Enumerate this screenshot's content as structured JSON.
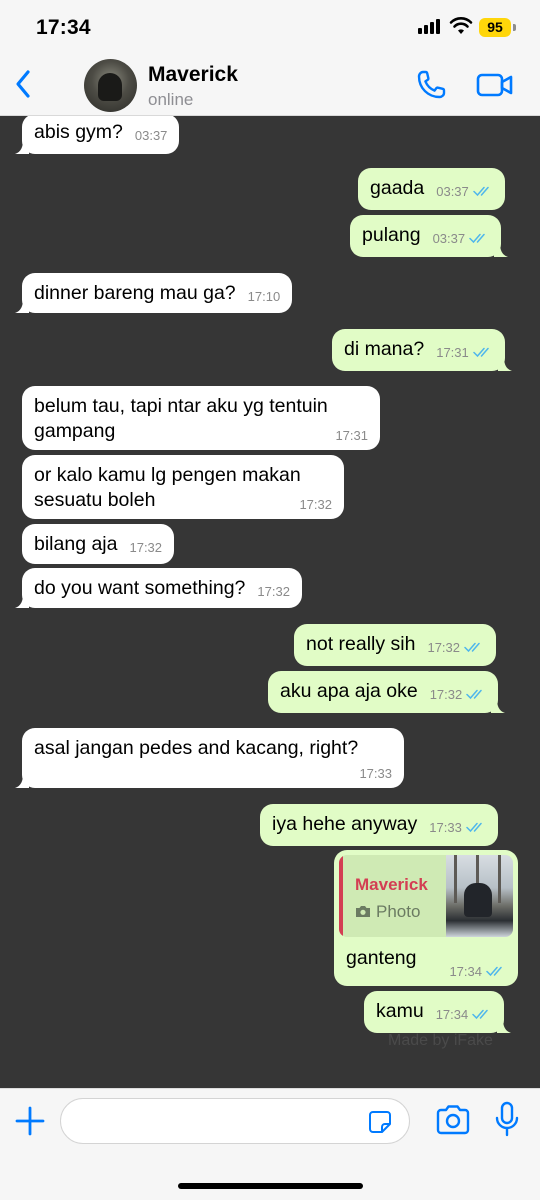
{
  "status": {
    "time": "17:34",
    "battery": "95"
  },
  "header": {
    "name": "Maverick",
    "status": "online"
  },
  "messages": [
    {
      "dir": "in",
      "text": "abis gym?",
      "time": "03:37"
    },
    {
      "dir": "out",
      "text": "gaada",
      "time": "03:37"
    },
    {
      "dir": "out",
      "text": "pulang",
      "time": "03:37"
    },
    {
      "dir": "in",
      "text": "dinner bareng mau ga?",
      "time": "17:10"
    },
    {
      "dir": "out",
      "text": "di mana?",
      "time": "17:31"
    },
    {
      "dir": "in",
      "text": "belum tau, tapi ntar aku yg tentuin gampang",
      "time": "17:31"
    },
    {
      "dir": "in",
      "text": "or kalo kamu lg pengen makan sesuatu boleh",
      "time": "17:32"
    },
    {
      "dir": "in",
      "text": "bilang aja",
      "time": "17:32"
    },
    {
      "dir": "in",
      "text": "do you want something?",
      "time": "17:32"
    },
    {
      "dir": "out",
      "text": "not really sih",
      "time": "17:32"
    },
    {
      "dir": "out",
      "text": "aku apa aja oke",
      "time": "17:32"
    },
    {
      "dir": "in",
      "text": "asal jangan pedes and kacang, right?",
      "time": "17:33"
    },
    {
      "dir": "out",
      "text": "iya hehe anyway",
      "time": "17:33"
    },
    {
      "dir": "out",
      "text": "ganteng",
      "time": "17:34",
      "reply_name": "Maverick",
      "reply_type": "Photo"
    },
    {
      "dir": "out",
      "text": "kamu",
      "time": "17:34"
    }
  ],
  "watermark": "Made by iFake",
  "colors": {
    "accent": "#007aff",
    "outgoing": "#e1fcc6",
    "incoming": "#ffffff",
    "chat_bg": "#363636",
    "read_ticks": "#4fb6ec",
    "reply_name": "#d33e53"
  },
  "icons": [
    "back-icon",
    "phone-icon",
    "video-icon",
    "plus-icon",
    "sticker-icon",
    "camera-icon",
    "mic-icon",
    "double-check-icon"
  ]
}
